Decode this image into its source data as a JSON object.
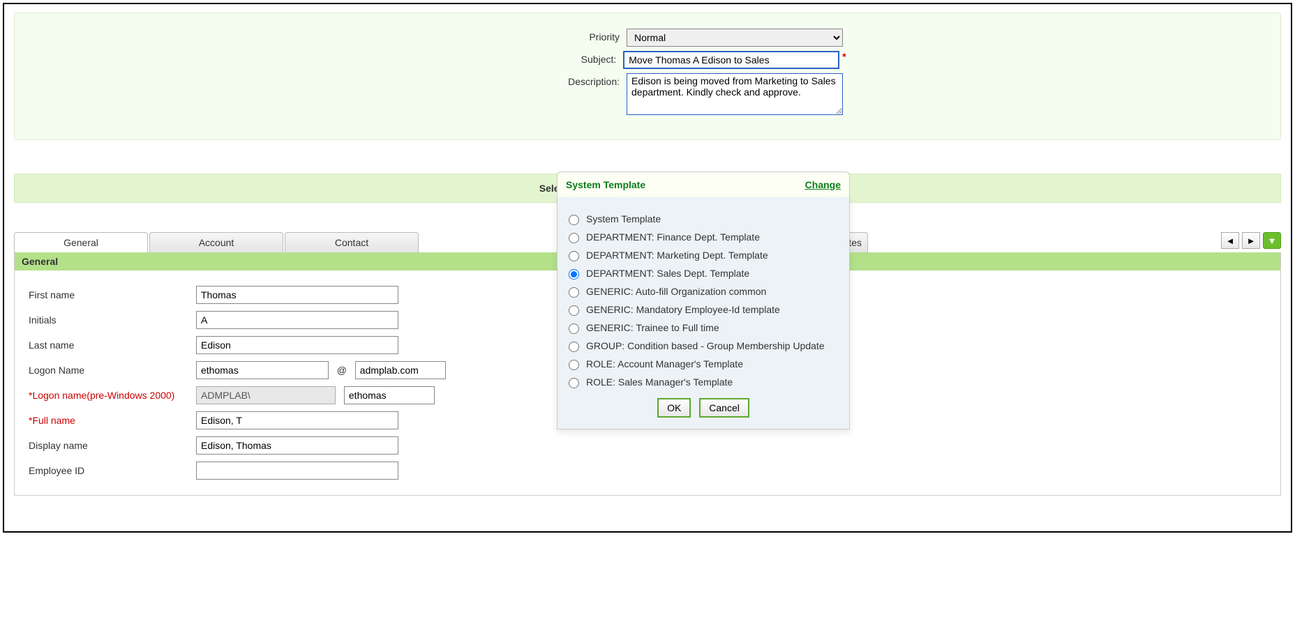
{
  "form": {
    "priority_label": "Priority",
    "priority_value": "Normal",
    "subject_label": "Subject:",
    "subject_value": "Move Thomas A Edison to Sales",
    "description_label": "Description:",
    "description_value": "Edison is being moved from Marketing to Sales department. Kindly check and approve."
  },
  "template_bar": {
    "label": "Selected Template :",
    "current": "System Template",
    "change_label": "Change",
    "ok_label": "OK",
    "cancel_label": "Cancel",
    "options": [
      {
        "label": "System Template",
        "selected": false
      },
      {
        "label": "DEPARTMENT: Finance Dept. Template",
        "selected": false
      },
      {
        "label": "DEPARTMENT: Marketing Dept. Template",
        "selected": false
      },
      {
        "label": "DEPARTMENT: Sales Dept. Template",
        "selected": true
      },
      {
        "label": "GENERIC: Auto-fill Organization common",
        "selected": false
      },
      {
        "label": "GENERIC: Mandatory Employee-Id template",
        "selected": false
      },
      {
        "label": "GENERIC: Trainee to Full time",
        "selected": false
      },
      {
        "label": "GROUP: Condition based - Group Membership Update",
        "selected": false
      },
      {
        "label": "ROLE: Account Manager's Template",
        "selected": false
      },
      {
        "label": "ROLE: Sales Manager's Template",
        "selected": false
      }
    ]
  },
  "tabs": {
    "items": [
      "General",
      "Account",
      "Contact"
    ],
    "partial_right": "ttributes",
    "active_index": 0
  },
  "general": {
    "header": "General",
    "first_name_label": "First name",
    "first_name": "Thomas",
    "initials_label": "Initials",
    "initials": "A",
    "last_name_label": "Last name",
    "last_name": "Edison",
    "logon_label": "Logon Name",
    "logon_user": "ethomas",
    "logon_at": "@",
    "logon_domain": "admplab.com",
    "prewin_label": "Logon name(pre-Windows 2000)",
    "prewin_prefix": "ADMPLAB\\",
    "prewin_value": "ethomas",
    "fullname_label": "Full name",
    "fullname": "Edison, T",
    "displayname_label": "Display name",
    "displayname": "Edison, Thomas",
    "employeeid_label": "Employee ID"
  }
}
